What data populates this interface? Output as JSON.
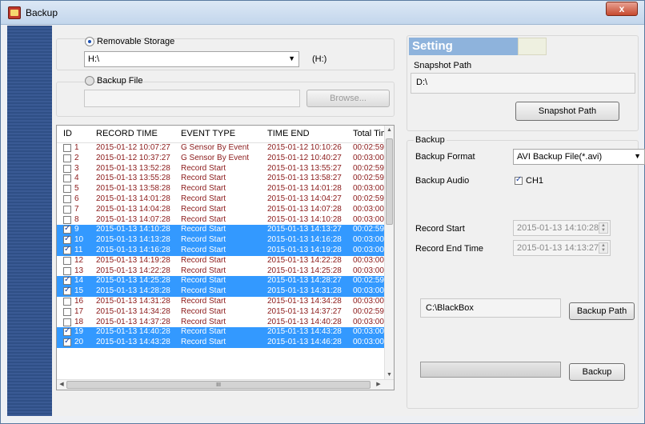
{
  "window": {
    "title": "Backup",
    "close_label": "x"
  },
  "source": {
    "removable_storage_label": "Removable Storage",
    "drive_selected": "H:\\",
    "drive_label": "(H:)",
    "backup_file_label": "Backup File",
    "backup_file_value": "",
    "browse_label": "Browse..."
  },
  "table": {
    "headers": [
      "ID",
      "RECORD TIME",
      "EVENT TYPE",
      "TIME END",
      "Total Tim"
    ],
    "rows": [
      {
        "id": "1",
        "record_time": "2015-01-12 10:07:27",
        "event": "G Sensor By Event",
        "time_end": "2015-01-12 10:10:26",
        "total": "00:02:59",
        "checked": false,
        "selected": false
      },
      {
        "id": "2",
        "record_time": "2015-01-12 10:37:27",
        "event": "G Sensor By Event",
        "time_end": "2015-01-12 10:40:27",
        "total": "00:03:00",
        "checked": false,
        "selected": false
      },
      {
        "id": "3",
        "record_time": "2015-01-13 13:52:28",
        "event": "Record Start",
        "time_end": "2015-01-13 13:55:27",
        "total": "00:02:59",
        "checked": false,
        "selected": false
      },
      {
        "id": "4",
        "record_time": "2015-01-13 13:55:28",
        "event": "Record Start",
        "time_end": "2015-01-13 13:58:27",
        "total": "00:02:59",
        "checked": false,
        "selected": false
      },
      {
        "id": "5",
        "record_time": "2015-01-13 13:58:28",
        "event": "Record Start",
        "time_end": "2015-01-13 14:01:28",
        "total": "00:03:00",
        "checked": false,
        "selected": false
      },
      {
        "id": "6",
        "record_time": "2015-01-13 14:01:28",
        "event": "Record Start",
        "time_end": "2015-01-13 14:04:27",
        "total": "00:02:59",
        "checked": false,
        "selected": false
      },
      {
        "id": "7",
        "record_time": "2015-01-13 14:04:28",
        "event": "Record Start",
        "time_end": "2015-01-13 14:07:28",
        "total": "00:03:00",
        "checked": false,
        "selected": false
      },
      {
        "id": "8",
        "record_time": "2015-01-13 14:07:28",
        "event": "Record Start",
        "time_end": "2015-01-13 14:10:28",
        "total": "00:03:00",
        "checked": false,
        "selected": false
      },
      {
        "id": "9",
        "record_time": "2015-01-13 14:10:28",
        "event": "Record Start",
        "time_end": "2015-01-13 14:13:27",
        "total": "00:02:59",
        "checked": true,
        "selected": true
      },
      {
        "id": "10",
        "record_time": "2015-01-13 14:13:28",
        "event": "Record Start",
        "time_end": "2015-01-13 14:16:28",
        "total": "00:03:00",
        "checked": true,
        "selected": true
      },
      {
        "id": "11",
        "record_time": "2015-01-13 14:16:28",
        "event": "Record Start",
        "time_end": "2015-01-13 14:19:28",
        "total": "00:03:00",
        "checked": true,
        "selected": true
      },
      {
        "id": "12",
        "record_time": "2015-01-13 14:19:28",
        "event": "Record Start",
        "time_end": "2015-01-13 14:22:28",
        "total": "00:03:00",
        "checked": false,
        "selected": false
      },
      {
        "id": "13",
        "record_time": "2015-01-13 14:22:28",
        "event": "Record Start",
        "time_end": "2015-01-13 14:25:28",
        "total": "00:03:00",
        "checked": false,
        "selected": false
      },
      {
        "id": "14",
        "record_time": "2015-01-13 14:25:28",
        "event": "Record Start",
        "time_end": "2015-01-13 14:28:27",
        "total": "00:02:59",
        "checked": true,
        "selected": true
      },
      {
        "id": "15",
        "record_time": "2015-01-13 14:28:28",
        "event": "Record Start",
        "time_end": "2015-01-13 14:31:28",
        "total": "00:03:00",
        "checked": true,
        "selected": true
      },
      {
        "id": "16",
        "record_time": "2015-01-13 14:31:28",
        "event": "Record Start",
        "time_end": "2015-01-13 14:34:28",
        "total": "00:03:00",
        "checked": false,
        "selected": false
      },
      {
        "id": "17",
        "record_time": "2015-01-13 14:34:28",
        "event": "Record Start",
        "time_end": "2015-01-13 14:37:27",
        "total": "00:02:59",
        "checked": false,
        "selected": false
      },
      {
        "id": "18",
        "record_time": "2015-01-13 14:37:28",
        "event": "Record Start",
        "time_end": "2015-01-13 14:40:28",
        "total": "00:03:00",
        "checked": false,
        "selected": false
      },
      {
        "id": "19",
        "record_time": "2015-01-13 14:40:28",
        "event": "Record Start",
        "time_end": "2015-01-13 14:43:28",
        "total": "00:03:00",
        "checked": true,
        "selected": true
      },
      {
        "id": "20",
        "record_time": "2015-01-13 14:43:28",
        "event": "Record Start",
        "time_end": "2015-01-13 14:46:28",
        "total": "00:03:00",
        "checked": true,
        "selected": true
      }
    ],
    "hscroll_thumb_glyph": "III"
  },
  "setting": {
    "header": "Setting",
    "snapshot_group_label": "Snapshot Path",
    "snapshot_path_value": "D:\\",
    "snapshot_button": "Snapshot Path",
    "backup_group_label": "Backup",
    "backup_format_label": "Backup Format",
    "backup_format_value": "AVI Backup File(*.avi)",
    "backup_audio_label": "Backup Audio",
    "audio_channel_label": "CH1",
    "record_start_label": "Record Start",
    "record_start_value": "2015-01-13 14:10:28",
    "record_end_label": "Record End Time",
    "record_end_value": "2015-01-13 14:13:27",
    "backup_path_value": "C:\\BlackBox",
    "backup_path_button": "Backup Path",
    "backup_button": "Backup",
    "progress": 0
  }
}
